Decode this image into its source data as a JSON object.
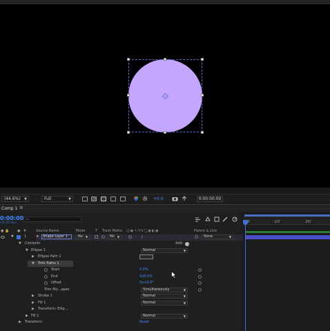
{
  "viewer": {
    "shape_color": "#c5a6ff",
    "bbox_color": "#5a6ad6",
    "toolbar": {
      "magnification": "(44.6%)",
      "resolution": "Full",
      "exposure": "+0.0",
      "timecode": "0:00:00:00"
    }
  },
  "timeline": {
    "tab_label": "Comp 1",
    "tab_menu_icon": "hamburger-menu-icon",
    "current_time": "0:00:00",
    "fps": "(30.00 fps)",
    "search_placeholder": "⌕ₐ",
    "columns": {
      "source_name": "Source Name",
      "mode": "Mode",
      "t": "T",
      "track_matte": "Track Matte",
      "parent_link": "Parent & Link"
    },
    "layer": {
      "number": "1",
      "name": "Shape Layer 1",
      "mode": "No",
      "matte": "No",
      "parent": "None",
      "label_color": "#3f6fd9"
    },
    "rows": [
      {
        "label": "Contents",
        "add_label": "Add:"
      },
      {
        "label": "Ellipse 1",
        "blend": "Normal"
      },
      {
        "label": "Ellipse Path 1"
      },
      {
        "label": "Trim Paths 1"
      },
      {
        "label": "Start",
        "value": "0.0%"
      },
      {
        "label": "End",
        "value": "100.0%"
      },
      {
        "label": "Offset",
        "value": "0x+0.0°"
      },
      {
        "label": "Trim Mu...apes",
        "select": "Simultaneously"
      },
      {
        "label": "Stroke 1",
        "blend": "Normal"
      },
      {
        "label": "Fill 1",
        "blend": "Normal"
      },
      {
        "label": "Transform: Ellip..."
      },
      {
        "label": "Fill 1",
        "blend": "Normal"
      },
      {
        "label": "Transform",
        "value": "Reset"
      }
    ],
    "ruler": {
      "labels": [
        "0f",
        "10f",
        "20f"
      ]
    }
  }
}
